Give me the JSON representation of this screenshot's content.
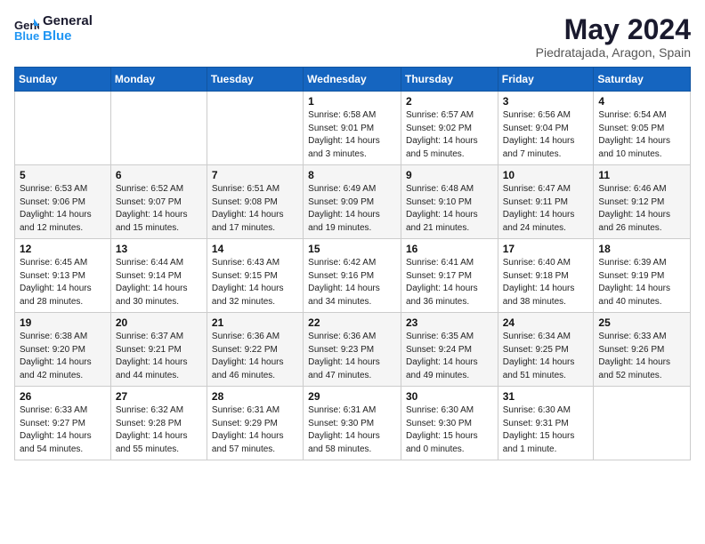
{
  "logo": {
    "line1": "General",
    "line2": "Blue"
  },
  "title": "May 2024",
  "location": "Piedratajada, Aragon, Spain",
  "days_of_week": [
    "Sunday",
    "Monday",
    "Tuesday",
    "Wednesday",
    "Thursday",
    "Friday",
    "Saturday"
  ],
  "weeks": [
    [
      {
        "day": "",
        "info": ""
      },
      {
        "day": "",
        "info": ""
      },
      {
        "day": "",
        "info": ""
      },
      {
        "day": "1",
        "info": "Sunrise: 6:58 AM\nSunset: 9:01 PM\nDaylight: 14 hours\nand 3 minutes."
      },
      {
        "day": "2",
        "info": "Sunrise: 6:57 AM\nSunset: 9:02 PM\nDaylight: 14 hours\nand 5 minutes."
      },
      {
        "day": "3",
        "info": "Sunrise: 6:56 AM\nSunset: 9:04 PM\nDaylight: 14 hours\nand 7 minutes."
      },
      {
        "day": "4",
        "info": "Sunrise: 6:54 AM\nSunset: 9:05 PM\nDaylight: 14 hours\nand 10 minutes."
      }
    ],
    [
      {
        "day": "5",
        "info": "Sunrise: 6:53 AM\nSunset: 9:06 PM\nDaylight: 14 hours\nand 12 minutes."
      },
      {
        "day": "6",
        "info": "Sunrise: 6:52 AM\nSunset: 9:07 PM\nDaylight: 14 hours\nand 15 minutes."
      },
      {
        "day": "7",
        "info": "Sunrise: 6:51 AM\nSunset: 9:08 PM\nDaylight: 14 hours\nand 17 minutes."
      },
      {
        "day": "8",
        "info": "Sunrise: 6:49 AM\nSunset: 9:09 PM\nDaylight: 14 hours\nand 19 minutes."
      },
      {
        "day": "9",
        "info": "Sunrise: 6:48 AM\nSunset: 9:10 PM\nDaylight: 14 hours\nand 21 minutes."
      },
      {
        "day": "10",
        "info": "Sunrise: 6:47 AM\nSunset: 9:11 PM\nDaylight: 14 hours\nand 24 minutes."
      },
      {
        "day": "11",
        "info": "Sunrise: 6:46 AM\nSunset: 9:12 PM\nDaylight: 14 hours\nand 26 minutes."
      }
    ],
    [
      {
        "day": "12",
        "info": "Sunrise: 6:45 AM\nSunset: 9:13 PM\nDaylight: 14 hours\nand 28 minutes."
      },
      {
        "day": "13",
        "info": "Sunrise: 6:44 AM\nSunset: 9:14 PM\nDaylight: 14 hours\nand 30 minutes."
      },
      {
        "day": "14",
        "info": "Sunrise: 6:43 AM\nSunset: 9:15 PM\nDaylight: 14 hours\nand 32 minutes."
      },
      {
        "day": "15",
        "info": "Sunrise: 6:42 AM\nSunset: 9:16 PM\nDaylight: 14 hours\nand 34 minutes."
      },
      {
        "day": "16",
        "info": "Sunrise: 6:41 AM\nSunset: 9:17 PM\nDaylight: 14 hours\nand 36 minutes."
      },
      {
        "day": "17",
        "info": "Sunrise: 6:40 AM\nSunset: 9:18 PM\nDaylight: 14 hours\nand 38 minutes."
      },
      {
        "day": "18",
        "info": "Sunrise: 6:39 AM\nSunset: 9:19 PM\nDaylight: 14 hours\nand 40 minutes."
      }
    ],
    [
      {
        "day": "19",
        "info": "Sunrise: 6:38 AM\nSunset: 9:20 PM\nDaylight: 14 hours\nand 42 minutes."
      },
      {
        "day": "20",
        "info": "Sunrise: 6:37 AM\nSunset: 9:21 PM\nDaylight: 14 hours\nand 44 minutes."
      },
      {
        "day": "21",
        "info": "Sunrise: 6:36 AM\nSunset: 9:22 PM\nDaylight: 14 hours\nand 46 minutes."
      },
      {
        "day": "22",
        "info": "Sunrise: 6:36 AM\nSunset: 9:23 PM\nDaylight: 14 hours\nand 47 minutes."
      },
      {
        "day": "23",
        "info": "Sunrise: 6:35 AM\nSunset: 9:24 PM\nDaylight: 14 hours\nand 49 minutes."
      },
      {
        "day": "24",
        "info": "Sunrise: 6:34 AM\nSunset: 9:25 PM\nDaylight: 14 hours\nand 51 minutes."
      },
      {
        "day": "25",
        "info": "Sunrise: 6:33 AM\nSunset: 9:26 PM\nDaylight: 14 hours\nand 52 minutes."
      }
    ],
    [
      {
        "day": "26",
        "info": "Sunrise: 6:33 AM\nSunset: 9:27 PM\nDaylight: 14 hours\nand 54 minutes."
      },
      {
        "day": "27",
        "info": "Sunrise: 6:32 AM\nSunset: 9:28 PM\nDaylight: 14 hours\nand 55 minutes."
      },
      {
        "day": "28",
        "info": "Sunrise: 6:31 AM\nSunset: 9:29 PM\nDaylight: 14 hours\nand 57 minutes."
      },
      {
        "day": "29",
        "info": "Sunrise: 6:31 AM\nSunset: 9:30 PM\nDaylight: 14 hours\nand 58 minutes."
      },
      {
        "day": "30",
        "info": "Sunrise: 6:30 AM\nSunset: 9:30 PM\nDaylight: 15 hours\nand 0 minutes."
      },
      {
        "day": "31",
        "info": "Sunrise: 6:30 AM\nSunset: 9:31 PM\nDaylight: 15 hours\nand 1 minute."
      },
      {
        "day": "",
        "info": ""
      }
    ]
  ]
}
